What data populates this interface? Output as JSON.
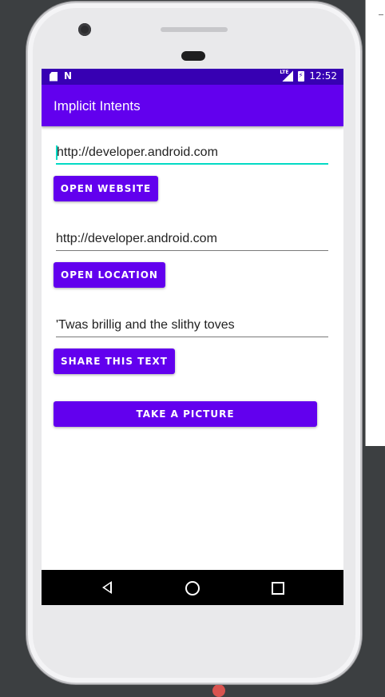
{
  "status_bar": {
    "time": "12:52",
    "network_label": "LTE"
  },
  "app_bar": {
    "title": "Implicit Intents"
  },
  "website_field": {
    "value": "http://developer.android.com"
  },
  "open_website_button": {
    "label": "OPEN WEBSITE"
  },
  "location_field": {
    "value": "http://developer.android.com"
  },
  "open_location_button": {
    "label": "OPEN LOCATION"
  },
  "share_field": {
    "value": "'Twas brillig and the slithy toves"
  },
  "share_text_button": {
    "label": "SHARE THIS TEXT"
  },
  "take_picture_button": {
    "label": "TAKE A PICTURE"
  },
  "colors": {
    "primary": "#6200ee",
    "primary_dark": "#3700b3",
    "accent": "#03dac5"
  },
  "icons": {
    "status_left": [
      "sd-card-icon",
      "n-notification-icon"
    ],
    "status_right": [
      "lte-signal-icon",
      "battery-charging-icon"
    ],
    "nav": [
      "back-icon",
      "home-icon",
      "recents-icon"
    ]
  }
}
